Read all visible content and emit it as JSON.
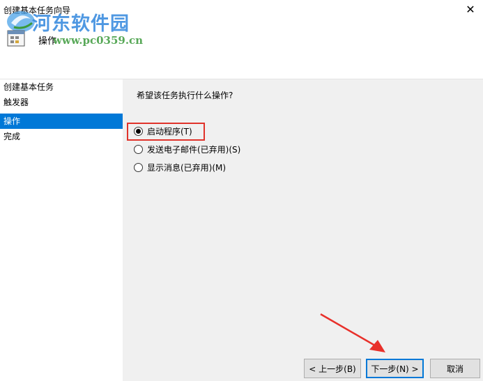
{
  "window": {
    "title": "创建基本任务向导",
    "close_glyph": "✕"
  },
  "header": {
    "section_heading": "操作",
    "watermark_title": "河东软件园",
    "watermark_url": "www.pc0359.cn"
  },
  "nav": {
    "items": [
      {
        "label": "创建基本任务",
        "selected": false
      },
      {
        "label": "触发器",
        "selected": false
      },
      {
        "label": "操作",
        "selected": true
      },
      {
        "label": "完成",
        "selected": false
      }
    ]
  },
  "main": {
    "question": "希望该任务执行什么操作?",
    "options": [
      {
        "label": "启动程序(T)",
        "checked": true
      },
      {
        "label": "发送电子邮件(已弃用)(S)",
        "checked": false
      },
      {
        "label": "显示消息(已弃用)(M)",
        "checked": false
      }
    ]
  },
  "buttons": {
    "back": "< 上一步(B)",
    "next": "下一步(N) >",
    "cancel": "取消"
  },
  "colors": {
    "selection": "#0078d7",
    "highlight": "#e0322a",
    "watermark_blue": "#3c8ddf",
    "watermark_green": "#3b9a3b"
  },
  "icons": {
    "task": "task-scheduler-icon",
    "close": "close-icon"
  }
}
